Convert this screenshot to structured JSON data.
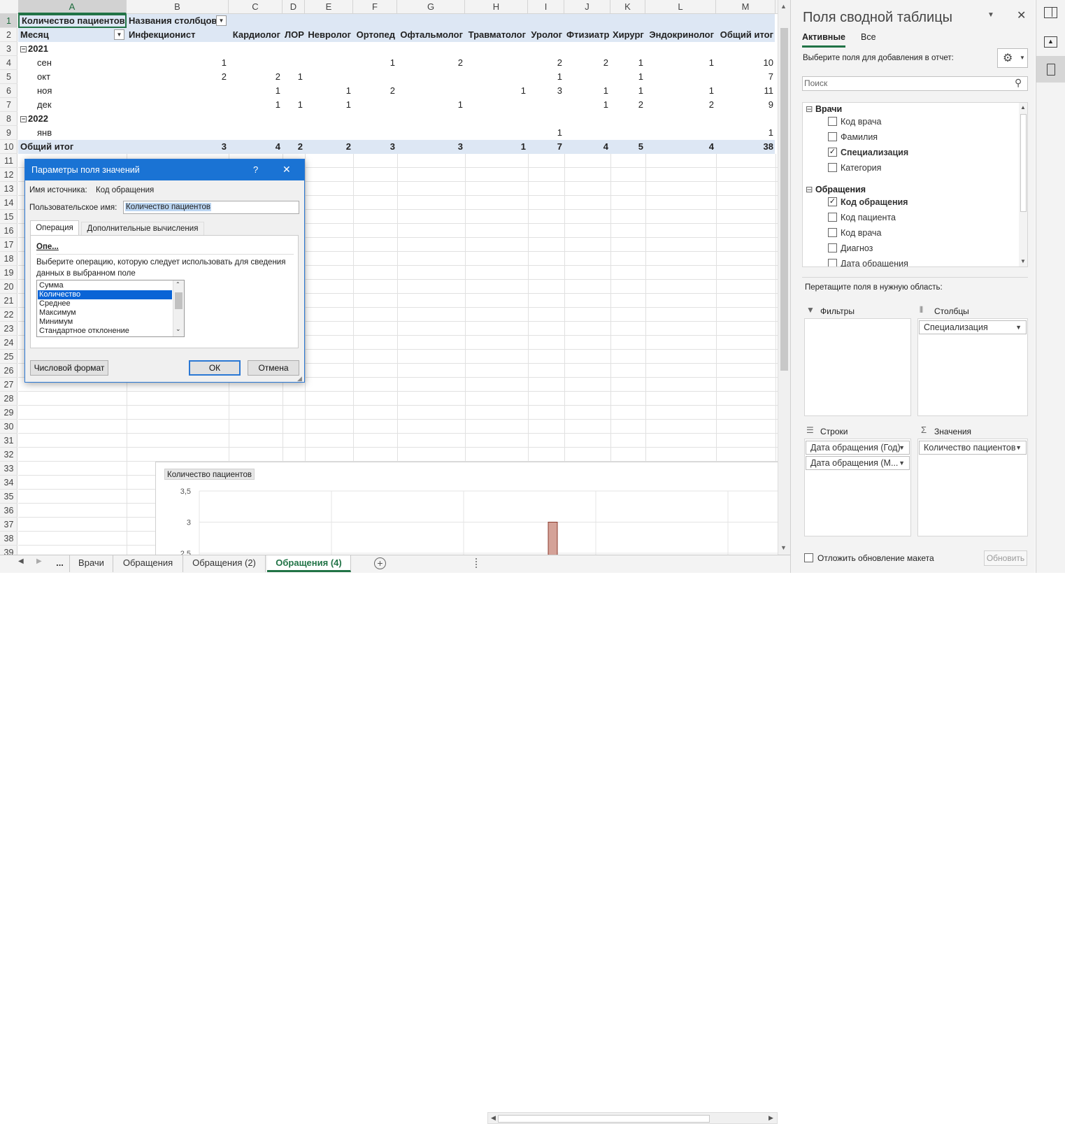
{
  "sheet": {
    "columns": [
      "A",
      "B",
      "C",
      "D",
      "E",
      "F",
      "G",
      "H",
      "I",
      "J",
      "K",
      "L",
      "M"
    ],
    "rows": [
      "1",
      "2",
      "3",
      "4",
      "5",
      "6",
      "7",
      "8",
      "9",
      "10",
      "11",
      "12",
      "13",
      "14",
      "15",
      "16",
      "17",
      "18",
      "19",
      "20",
      "21",
      "22",
      "23",
      "24",
      "25",
      "26",
      "27",
      "28",
      "29",
      "30",
      "31",
      "32",
      "33",
      "34",
      "35",
      "36",
      "37",
      "38",
      "39"
    ],
    "pivot": {
      "value_header": "Количество пациентов",
      "columns_header": "Названия столбцов",
      "row_header": "Месяц",
      "specialties": [
        "Инфекционист",
        "Кардиолог",
        "ЛОР",
        "Невролог",
        "Ортопед",
        "Офтальмолог",
        "Травматолог",
        "Уролог",
        "Фтизиатр",
        "Хирург",
        "Эндокринолог",
        "Общий итог"
      ],
      "year1": "2021",
      "year2": "2022",
      "rows": [
        {
          "label": "сен",
          "values": [
            "1",
            "",
            "",
            "",
            "1",
            "2",
            "",
            "2",
            "2",
            "1",
            "1",
            "10"
          ]
        },
        {
          "label": "окт",
          "values": [
            "2",
            "2",
            "1",
            "",
            "",
            "",
            "",
            "1",
            "",
            "1",
            "",
            "7"
          ]
        },
        {
          "label": "ноя",
          "values": [
            "",
            "1",
            "",
            "1",
            "2",
            "",
            "1",
            "3",
            "1",
            "1",
            "1",
            "11"
          ]
        },
        {
          "label": "дек",
          "values": [
            "",
            "1",
            "1",
            "1",
            "",
            "1",
            "",
            "",
            "1",
            "2",
            "2",
            "9"
          ]
        },
        {
          "label": "янв",
          "values": [
            "",
            "",
            "",
            "",
            "",
            "",
            "",
            "1",
            "",
            "",
            "",
            "1"
          ]
        }
      ],
      "total": {
        "label": "Общий итог",
        "values": [
          "3",
          "4",
          "2",
          "2",
          "3",
          "3",
          "1",
          "7",
          "4",
          "5",
          "4",
          "38"
        ]
      }
    }
  },
  "chart": {
    "title": "Количество пациентов",
    "chart_data": {
      "type": "bar",
      "title": "Количество пациентов",
      "ylim": [
        2.5,
        3.5
      ],
      "y_ticks": [
        "3,5",
        "3",
        "2,5"
      ],
      "values": [
        3
      ]
    }
  },
  "tabs": {
    "more": "...",
    "items": [
      "Врачи",
      "Обращения",
      "Обращения (2)",
      "Обращения (4)"
    ],
    "active_index": 3
  },
  "dialog": {
    "title": "Параметры поля значений",
    "help": "?",
    "close": "✕",
    "source_label": "Имя источника:",
    "source_value": "Код обращения",
    "custom_label": "Пользовательское имя:",
    "custom_value": "Количество пациентов",
    "tab_operation": "Операция",
    "tab_additional": "Дополнительные вычисления",
    "section": "Опе...",
    "description": "Выберите операцию, которую следует использовать для сведения данных в выбранном поле",
    "operations": [
      "Сумма",
      "Количество",
      "Среднее",
      "Максимум",
      "Минимум",
      "Стандартное отклонение"
    ],
    "selected_operation": "Количество",
    "number_format": "Числовой формат",
    "ok": "ОК",
    "cancel": "Отмена"
  },
  "pane": {
    "title": "Поля сводной таблицы",
    "tab_active": "Активные",
    "tab_all": "Все",
    "choose_label": "Выберите поля для добавления в отчет:",
    "search_placeholder": "Поиск",
    "table1": {
      "name": "Врачи",
      "fields": [
        {
          "name": "Код врача",
          "checked": false
        },
        {
          "name": "Фамилия",
          "checked": false
        },
        {
          "name": "Специализация",
          "checked": true
        },
        {
          "name": "Категория",
          "checked": false
        }
      ]
    },
    "table2": {
      "name": "Обращения",
      "fields": [
        {
          "name": "Код обращения",
          "checked": true
        },
        {
          "name": "Код пациента",
          "checked": false
        },
        {
          "name": "Код врача",
          "checked": false
        },
        {
          "name": "Диагноз",
          "checked": false
        },
        {
          "name": "Дата обращения",
          "checked": false
        }
      ]
    },
    "drag_label": "Перетащите поля в нужную область:",
    "filters": "Фильтры",
    "columns": "Столбцы",
    "columns_item": "Специализация",
    "rows": "Строки",
    "rows_items": [
      "Дата обращения (Год)",
      "Дата обращения (М..."
    ],
    "values": "Значения",
    "values_item": "Количество пациентов",
    "defer_label": "Отложить обновление макета",
    "update_button": "Обновить"
  }
}
